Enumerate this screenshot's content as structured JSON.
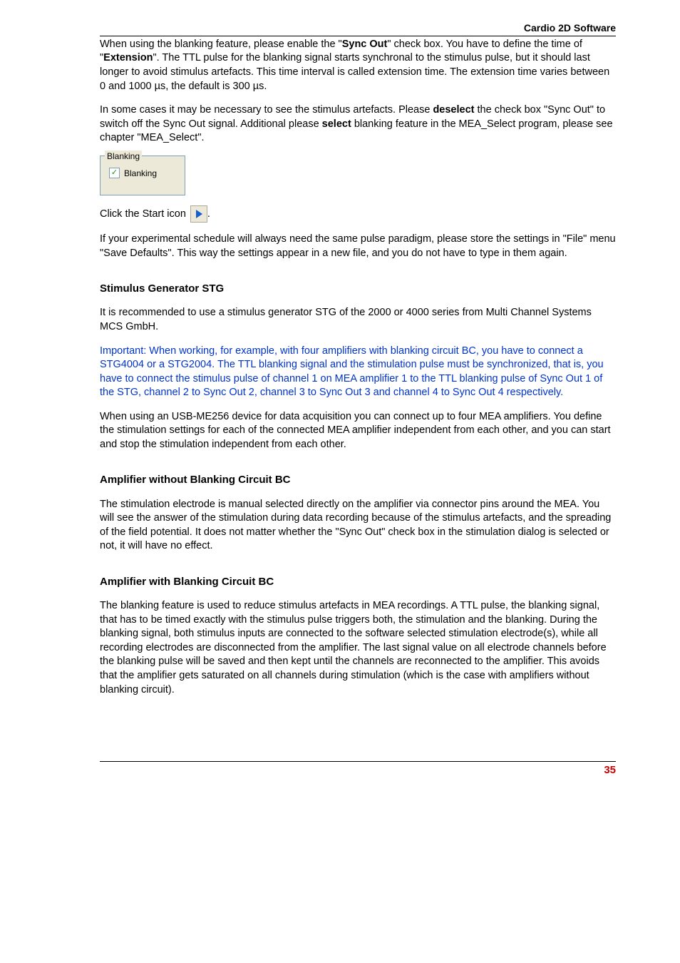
{
  "header": {
    "title": "Cardio 2D Software"
  },
  "para1": "When using the blanking feature, please enable the \"",
  "para1_b1": "Sync Out",
  "para1_mid1": "\" check box. You have to define the time of \"",
  "para1_b2": "Extension",
  "para1_tail": "\". The TTL pulse for the blanking signal starts synchronal to the stimulus pulse, but it should last longer to avoid stimulus artefacts. This time interval is called extension time. The extension time varies between 0 and 1000 µs, the default is 300 µs.",
  "para2_lead": "In some cases it may be necessary to see the stimulus artefacts. Please ",
  "para2_b1": "deselect",
  "para2_mid": "  the check box \"Sync Out\" to switch off the Sync Out signal. Additional please ",
  "para2_b2": "select",
  "para2_tail": " blanking feature in the MEA_Select program, please see chapter \"MEA_Select\".",
  "group": {
    "legend": "Blanking",
    "check_label": "Blanking",
    "checked": true
  },
  "start_line_lead": "Click the Start icon ",
  "start_line_tail": ".",
  "para3": "If your experimental schedule will always need the same pulse paradigm, please store the settings in \"File\" menu \"Save Defaults\". This way the settings appear in a new file, and you do not have to type in them again.",
  "sec1_title": "Stimulus Generator STG",
  "sec1_p1": "It is recommended to use a stimulus generator STG of the 2000 or 4000 series from Multi Channel Systems MCS GmbH.",
  "sec1_important": "Important: When working, for example, with four amplifiers with blanking circuit BC, you have to connect a STG4004 or a STG2004. The TTL blanking signal and the stimulation pulse must be synchronized, that is, you have to connect the stimulus pulse of channel 1 on MEA amplifier 1 to the TTL blanking pulse of Sync Out 1 of the STG, channel 2 to Sync Out 2, channel 3 to Sync Out 3 and channel 4 to Sync Out 4 respectively.",
  "sec1_p3": "When using an USB-ME256 device for data acquisition you can connect up to four MEA amplifiers. You define the stimulation settings for each of the connected MEA amplifier independent from each other, and you can start and stop the stimulation independent from each other.",
  "sec2_title": "Amplifier without Blanking Circuit BC",
  "sec2_p1": "The stimulation electrode is manual selected directly on the amplifier via connector pins around the MEA. You will see the answer of the stimulation during data recording because of the stimulus artefacts, and the spreading of the field potential. It does not matter whether the \"Sync Out\" check box in the stimulation dialog is selected or not, it will have no effect.",
  "sec3_title": "Amplifier with Blanking Circuit BC",
  "sec3_p1": "The blanking feature is used to reduce stimulus artefacts in MEA recordings. A TTL pulse, the blanking signal, that has to be timed exactly with the stimulus pulse triggers both, the stimulation and the blanking. During the blanking signal, both stimulus inputs are connected to the software selected stimulation electrode(s), while all recording electrodes are disconnected from the amplifier. The last signal value on all electrode channels before the blanking pulse will be saved and then kept until the channels are reconnected to the amplifier. This avoids that the amplifier gets saturated on all channels during stimulation (which is the case with amplifiers without blanking circuit).",
  "footer": {
    "page": "35"
  }
}
